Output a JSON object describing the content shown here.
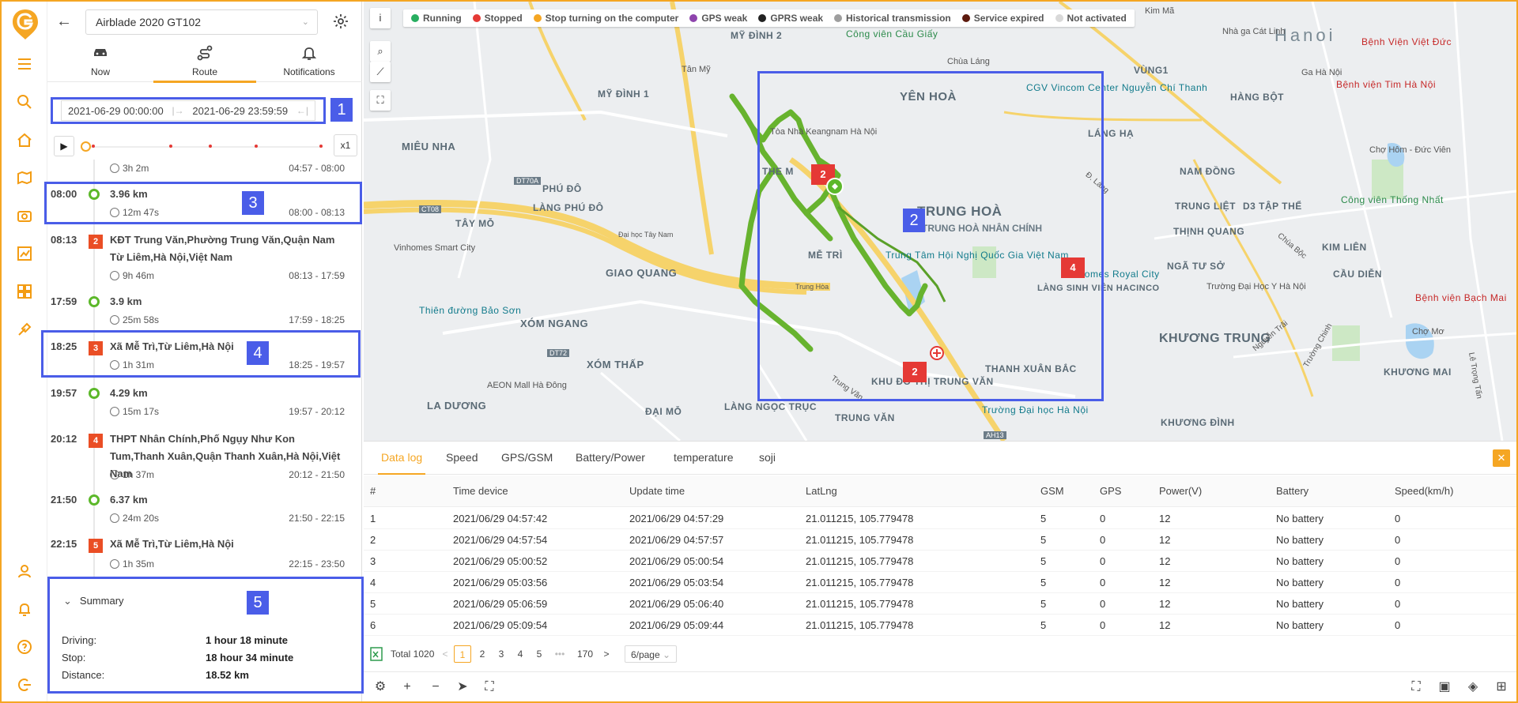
{
  "device": {
    "name": "Airblade 2020 GT102"
  },
  "tabs": [
    {
      "label": "Now",
      "icon": "car-icon"
    },
    {
      "label": "Route",
      "icon": "route-icon"
    },
    {
      "label": "Notifications",
      "icon": "bell-icon"
    }
  ],
  "active_tab": "Route",
  "date_range": {
    "start": "2021-06-29 00:00:00",
    "end": "2021-06-29 23:59:59",
    "separator": "|→",
    "end_icon": "←|"
  },
  "player": {
    "speed": "x1"
  },
  "timeline_partial": {
    "duration": "3h 2m",
    "range": "04:57 - 08:00"
  },
  "timeline": [
    {
      "time": "08:00",
      "type": "driving",
      "title": "3.96 km",
      "duration": "12m 47s",
      "range": "08:00 - 08:13"
    },
    {
      "time": "08:13",
      "type": "stop",
      "badge": "2",
      "title": "KĐT Trung Văn,Phường Trung Văn,Quận Nam Từ Liêm,Hà Nội,Việt Nam",
      "duration": "9h 46m",
      "range": "08:13 - 17:59"
    },
    {
      "time": "17:59",
      "type": "driving",
      "title": "3.9 km",
      "duration": "25m 58s",
      "range": "17:59 - 18:25"
    },
    {
      "time": "18:25",
      "type": "stop",
      "badge": "3",
      "title": "Xã Mễ Trì,Từ Liêm,Hà Nội",
      "duration": "1h 31m",
      "range": "18:25 - 19:57"
    },
    {
      "time": "19:57",
      "type": "driving",
      "title": "4.29 km",
      "duration": "15m 17s",
      "range": "19:57 - 20:12"
    },
    {
      "time": "20:12",
      "type": "stop",
      "badge": "4",
      "title": "THPT Nhân Chính,Phố Ngụy Như Kon Tum,Thanh Xuân,Quận Thanh Xuân,Hà Nội,Việt Nam",
      "duration": "1h 37m",
      "range": "20:12 - 21:50"
    },
    {
      "time": "21:50",
      "type": "driving",
      "title": "6.37 km",
      "duration": "24m 20s",
      "range": "21:50 - 22:15"
    },
    {
      "time": "22:15",
      "type": "stop",
      "badge": "5",
      "title": "Xã Mễ Trì,Từ Liêm,Hà Nội",
      "duration": "1h 35m",
      "range": "22:15 - 23:50"
    }
  ],
  "summary": {
    "title": "Summary",
    "rows": [
      {
        "label": "Driving:",
        "value": "1 hour 18 minute"
      },
      {
        "label": "Stop:",
        "value": "18 hour 34 minute"
      },
      {
        "label": "Distance:",
        "value": "18.52 km"
      }
    ]
  },
  "annotations": [
    "1",
    "2",
    "3",
    "4",
    "5"
  ],
  "legend": [
    {
      "label": "Running",
      "color": "#27ae60"
    },
    {
      "label": "Stopped",
      "color": "#e53935"
    },
    {
      "label": "Stop turning on the computer",
      "color": "#f5a623"
    },
    {
      "label": "GPS weak",
      "color": "#8e44ad"
    },
    {
      "label": "GPRS weak",
      "color": "#222222"
    },
    {
      "label": "Historical transmission",
      "color": "#9e9e9e"
    },
    {
      "label": "Service expired",
      "color": "#5d1a0e"
    },
    {
      "label": "Not activated",
      "color": "#d9d9d9"
    }
  ],
  "map": {
    "info_btn": "i",
    "places": {
      "yen_hoa": "YÊN HOÀ",
      "trung_hoa": "TRUNG HOÀ",
      "trung_hoa_nhan_chinh": "TRUNG HOÀ NHÂN CHÍNH",
      "me_tri": "MỄ TRÌ",
      "mieu_nha": "MIÊU NHA",
      "phu_do": "PHÚ ĐÔ",
      "lang_phu_do": "LÀNG PHÚ ĐÔ",
      "tay_mo": "TÂY MỖ",
      "giao_quang": "GIAO QUANG",
      "xom_ngang": "XÓM NGANG",
      "xom_thap": "XÓM THẤP",
      "la_duong": "LA DƯƠNG",
      "dai_mo": "ĐẠI MỖ",
      "lang_ngoc_truc": "LÀNG NGỌC TRỤC",
      "trung_van": "TRUNG VĂN",
      "khu_do_thi_trung_van": "KHU ĐÔ THỊ TRUNG VĂN",
      "thanh_xuan_bac": "THANH XUÂN BẮC",
      "khuong_trung": "KHƯƠNG TRUNG",
      "khuong_dinh": "KHƯƠNG ĐÌNH",
      "khuong_mai": "KHƯƠNG MAI",
      "thinh_quang": "THỊNH QUANG",
      "nga_tu_so": "NGÃ TƯ SỞ",
      "kim_lien": "KIM LIÊN",
      "lang_ha": "LÁNG HẠ",
      "nam_dong": "NAM ĐỒNG",
      "trung_liet": "TRUNG LIỆT",
      "hang_bot": "HÀNG BỘT",
      "my_dinh_1": "MỸ ĐÌNH 1",
      "my_dinh_2": "MỸ ĐÌNH 2",
      "vung_1": "VÙNG1",
      "hanoi": "Hanoi",
      "d3_tap_the": "D3 TẬP THỂ",
      "cau_dien": "CẦU DIỄN",
      "lang_sinh_vien": "LÀNG SINH VIÊN HACINCO",
      "the_m": "THE M",
      "keangnam": "Tòa Nhà Keangnam Hà Nội",
      "cgv": "CGV Vincom Center Nguyễn Chí Thanh",
      "chua_lang": "Chùa Láng",
      "cong_vien_cau_giay": "Công viên Cầu Giấy",
      "trung_tam_hoi_nghi": "Trung Tâm Hội Nghị Quốc Gia Việt Nam",
      "vinhomes_smart_city": "Vinhomes Smart City",
      "thien_duong_bao_son": "Thiên đường Bảo Sơn",
      "aeon": "AEON Mall Hà Đông",
      "vinhomes_royal_city": "Vinhomes Royal City",
      "truong_dai_hoc_ha_noi": "Trường Đại học Hà Nội",
      "truong_dai_hoc_y": "Trường Đại Học Y Hà Nội",
      "benh_vien_viet_duc": "Bệnh Viện Việt Đức",
      "benh_vien_tim": "Bệnh viện Tim Hà Nội",
      "benh_vien_bach_mai": "Bệnh viện Bạch Mai",
      "cho_hom": "Chợ Hôm - Đức Viên",
      "cho_mo": "Chợ Mơ",
      "cong_vien_thong_nhat": "Công viên Thống Nhất",
      "ga_ha_noi": "Ga Hà Nội",
      "nha_ga_cat_linh": "Nhà ga Cát Linh",
      "kim_ma": "Kim Mã",
      "dai_hoc_tay_nam": "Đại học Tây Nam",
      "tan_my": "Tân Mỹ",
      "trung_hoa_road": "Trung Hòa",
      "nguyen_trai": "Nguyễn Trãi",
      "truong_chinh": "Trường Chinh",
      "le_trong_tan": "Lê Trọng Tấn",
      "d_lang": "Đ. Láng",
      "chua_boc": "Chùa Bộc",
      "trung_van_road": "Trung Văn",
      "ct08": "CT08",
      "dt70a": "DT70A",
      "dt72": "DT72",
      "ah13": "AH13"
    },
    "badges": [
      "2",
      "2",
      "4"
    ]
  },
  "datalog": {
    "tabs": [
      "Data log",
      "Speed",
      "GPS/GSM",
      "Battery/Power",
      "temperature",
      "soji"
    ],
    "columns": [
      "#",
      "Time device",
      "Update time",
      "LatLng",
      "GSM",
      "GPS",
      "Power(V)",
      "Battery",
      "Speed(km/h)"
    ],
    "rows": [
      [
        "1",
        "2021/06/29 04:57:42",
        "2021/06/29 04:57:29",
        "21.011215, 105.779478",
        "5",
        "0",
        "12",
        "No battery",
        "0"
      ],
      [
        "2",
        "2021/06/29 04:57:54",
        "2021/06/29 04:57:57",
        "21.011215, 105.779478",
        "5",
        "0",
        "12",
        "No battery",
        "0"
      ],
      [
        "3",
        "2021/06/29 05:00:52",
        "2021/06/29 05:00:54",
        "21.011215, 105.779478",
        "5",
        "0",
        "12",
        "No battery",
        "0"
      ],
      [
        "4",
        "2021/06/29 05:03:56",
        "2021/06/29 05:03:54",
        "21.011215, 105.779478",
        "5",
        "0",
        "12",
        "No battery",
        "0"
      ],
      [
        "5",
        "2021/06/29 05:06:59",
        "2021/06/29 05:06:40",
        "21.011215, 105.779478",
        "5",
        "0",
        "12",
        "No battery",
        "0"
      ],
      [
        "6",
        "2021/06/29 05:09:54",
        "2021/06/29 05:09:44",
        "21.011215, 105.779478",
        "5",
        "0",
        "12",
        "No battery",
        "0"
      ]
    ],
    "total": "Total 1020",
    "pages": [
      "1",
      "2",
      "3",
      "4",
      "5",
      "•••",
      "170"
    ],
    "page_size": "6/page",
    "prev": "<",
    "next": ">"
  }
}
